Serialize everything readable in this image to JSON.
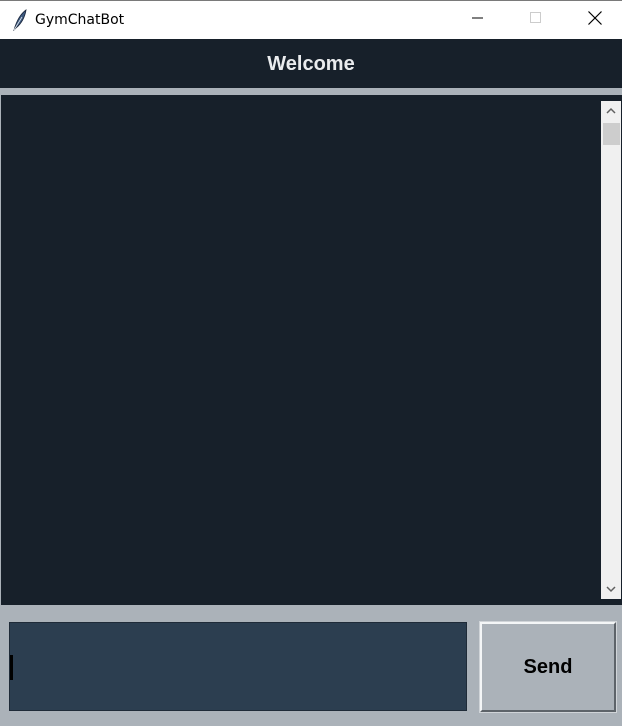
{
  "window": {
    "title": "GymChatBot",
    "app_icon": "feather-icon",
    "controls": {
      "minimize_icon": "minimize-icon",
      "maximize_icon": "maximize-icon",
      "close_icon": "close-icon"
    }
  },
  "header": {
    "title": "Welcome"
  },
  "chat": {
    "messages": []
  },
  "composer": {
    "input_value": "",
    "send_label": "Send"
  },
  "colors": {
    "header_bg": "#17202a",
    "header_text": "#eaecee",
    "divider": "#abb2b9",
    "chat_bg": "#17202a",
    "input_bg": "#2c3e50",
    "panel_bg": "#abb2b9",
    "button_bg": "#abb2b9"
  }
}
